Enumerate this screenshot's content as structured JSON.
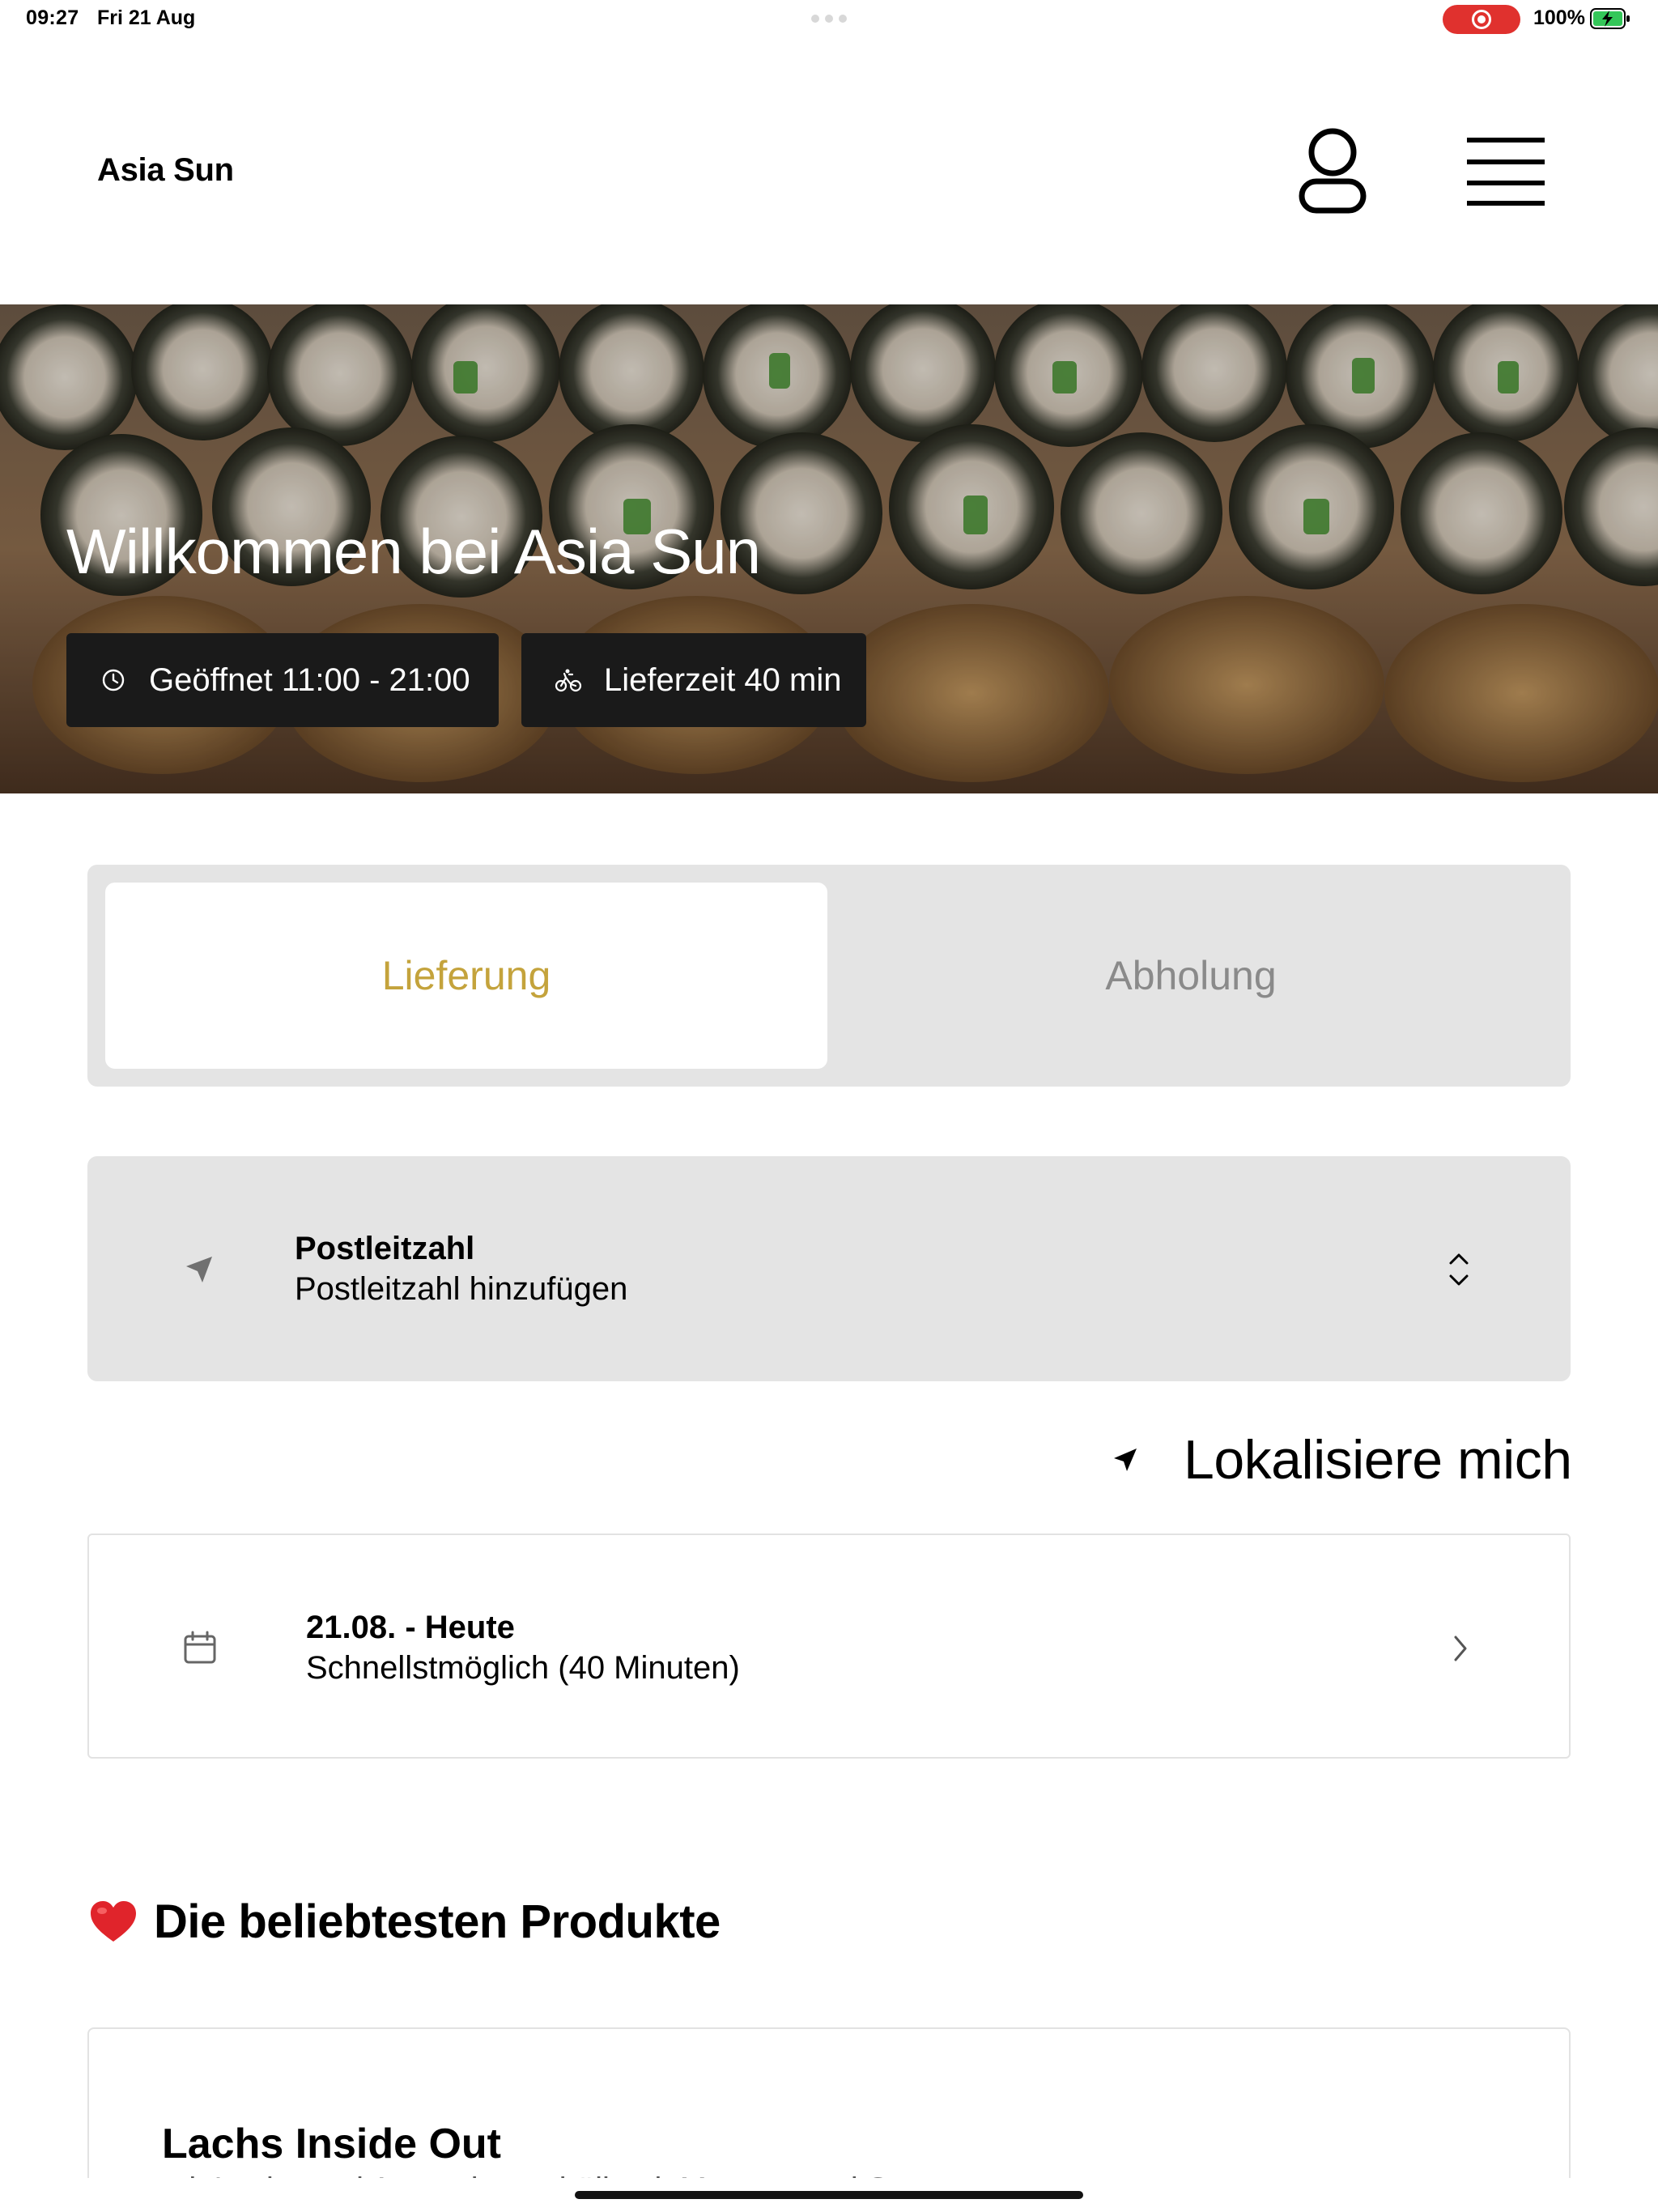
{
  "status_bar": {
    "time": "09:27",
    "date": "Fri 21 Aug",
    "battery_percent": "100%"
  },
  "header": {
    "brand": "Asia Sun",
    "icons": {
      "account": "person-icon",
      "menu": "hamburger-menu-icon"
    }
  },
  "hero": {
    "title": "Willkommen bei Asia Sun",
    "opening_hours": "Geöffnet 11:00 - 21:00",
    "delivery_time": "Lieferzeit 40 min",
    "icons": {
      "hours": "clock-icon",
      "delivery": "bicycle-icon"
    }
  },
  "order_mode": {
    "options": [
      "Lieferung",
      "Abholung"
    ],
    "selected": "Lieferung"
  },
  "postal_code": {
    "label": "Postleitzahl",
    "value": "Postleitzahl hinzufügen"
  },
  "localize": {
    "label": "Lokalisiere mich"
  },
  "schedule": {
    "label": "21.08. - Heute",
    "value": "Schnellstmöglich (40 Minuten)"
  },
  "popular": {
    "title": "Die beliebtesten Produkte",
    "products": [
      {
        "name": "Lachs Inside Out",
        "description": "mit Lachs und Avocado, umhüllt mit Masago und Sesam"
      }
    ]
  },
  "colors": {
    "accent": "#c4a33c",
    "segment_bg": "#e4e4e4",
    "badge_bg": "#1a1a1a",
    "record_red": "#e0312e",
    "heart_red": "#e0242b"
  }
}
